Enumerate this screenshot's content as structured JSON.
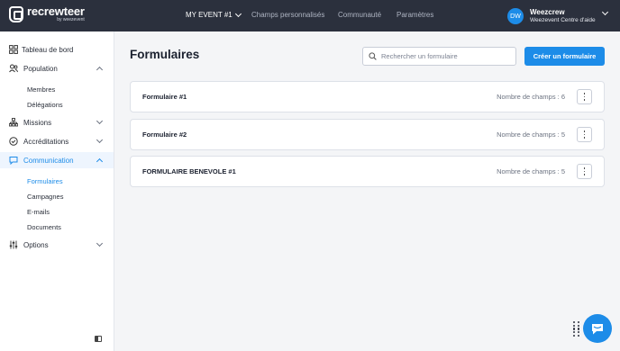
{
  "app": {
    "logo_name": "recrewteer",
    "logo_by": "by weezevent"
  },
  "topbar": {
    "event": "MY EVENT #1",
    "links": [
      "Champs personnalisés",
      "Communauté",
      "Paramètres"
    ],
    "user": {
      "initials": "DW",
      "name": "Weezcrew",
      "sub": "Weezevent Centre d'aide"
    }
  },
  "sidebar": {
    "items": {
      "dashboard": "Tableau de bord",
      "population": "Population",
      "missions": "Missions",
      "accreditations": "Accréditations",
      "communication": "Communication",
      "options": "Options"
    },
    "population_sub": [
      "Membres",
      "Délégations"
    ],
    "communication_sub": [
      "Formulaires",
      "Campagnes",
      "E-mails",
      "Documents"
    ]
  },
  "main": {
    "title": "Formulaires",
    "search_placeholder": "Rechercher un formulaire",
    "create_label": "Créer un formulaire",
    "forms": [
      {
        "name": "Formulaire #1",
        "count": "Nombre de champs : 6"
      },
      {
        "name": "Formulaire #2",
        "count": "Nombre de champs : 5"
      },
      {
        "name": "FORMULAIRE BENEVOLE #1",
        "count": "Nombre de champs : 5"
      }
    ]
  },
  "colors": {
    "accent": "#1d8ce8",
    "topbar": "#2b303d",
    "active_bg": "#eef5fe"
  },
  "icons": [
    "grid-icon",
    "users-icon",
    "sitemap-icon",
    "badge-check-icon",
    "message-icon",
    "sliders-icon",
    "search-icon",
    "kebab-icon",
    "sidebar-collapse-icon",
    "chat-icon",
    "drag-grip-icon"
  ]
}
